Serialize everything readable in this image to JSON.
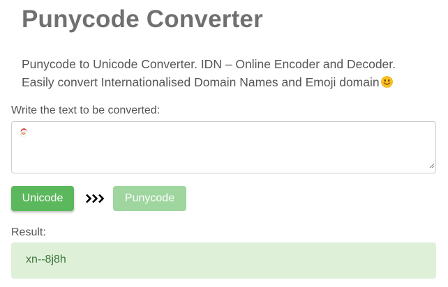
{
  "header": {
    "title": "Punycode Converter"
  },
  "description": {
    "line1": "Punycode to Unicode Converter. IDN – Online Encoder and Decoder.",
    "line2": "Easily convert Internationalised Domain Names and Emoji domain",
    "emoji_icon": "smiling-face-emoji-icon"
  },
  "input": {
    "label": "Write the text to be converted:",
    "value_icon": "santa-claus-emoji-icon"
  },
  "buttons": {
    "unicode_label": "Unicode",
    "separator_icon": "triple-chevron-right-icon",
    "punycode_label": "Punycode"
  },
  "result": {
    "label": "Result:",
    "value": "xn--8j8h"
  },
  "colors": {
    "primary_green": "#5cb85c",
    "disabled_green": "#9fd69f",
    "result_background": "#dff0d8",
    "result_text": "#3c763d"
  }
}
